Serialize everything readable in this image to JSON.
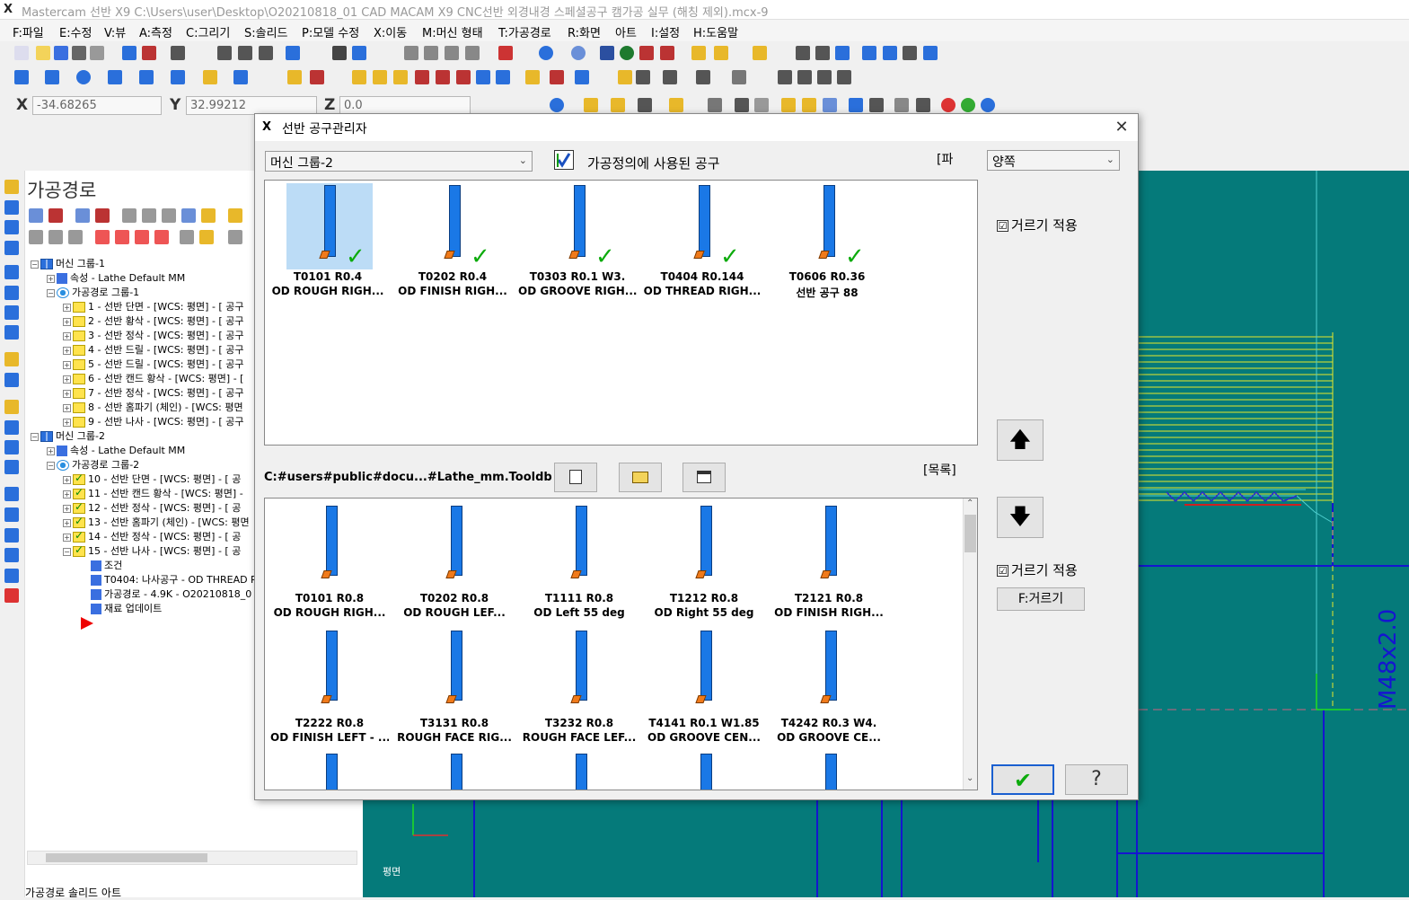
{
  "window_title": "Mastercam 선반 X9  C:\\Users\\user\\Desktop\\O20210818_01 CAD MACAM X9 CNC선반 외경내경 스페셜공구 캠가공 실무 (해칭 제외).mcx-9",
  "menu": [
    "F:파일",
    "E:수정",
    "V:뷰",
    "A:측정",
    "C:그리기",
    "S:솔리드",
    "P:모델 수정",
    "X:이동",
    "M:머신 형태",
    "T:가공경로",
    "R:화면",
    "아트",
    "I:설정",
    "H:도움말"
  ],
  "coords": {
    "x_label": "X",
    "x_value": "-34.68265",
    "y_label": "Y",
    "y_value": "32.99212",
    "z_label": "Z",
    "z_value": "0.0"
  },
  "panel": {
    "title": "가공경로",
    "tree": [
      {
        "text": "머신 그룹-1",
        "indent": 0,
        "icon": "grid",
        "exp": "−"
      },
      {
        "text": "속성 - Lathe Default MM",
        "indent": 1,
        "icon": "props",
        "exp": "+"
      },
      {
        "text": "가공경로 그룹-1",
        "indent": 1,
        "icon": "opsgroup",
        "exp": "−"
      },
      {
        "text": "1 - 선반 단면 - [WCS: 평면] - [ 공구",
        "indent": 2,
        "icon": "folder",
        "exp": "+"
      },
      {
        "text": "2 - 선반 황삭 - [WCS: 평면] - [ 공구",
        "indent": 2,
        "icon": "folder",
        "exp": "+"
      },
      {
        "text": "3 - 선반 정삭 - [WCS: 평면] - [ 공구",
        "indent": 2,
        "icon": "folder",
        "exp": "+"
      },
      {
        "text": "4 - 선반 드릴 - [WCS: 평면] - [ 공구",
        "indent": 2,
        "icon": "folder",
        "exp": "+"
      },
      {
        "text": "5 - 선반 드릴 - [WCS: 평면] - [ 공구",
        "indent": 2,
        "icon": "folder",
        "exp": "+"
      },
      {
        "text": "6 - 선반 캔드 황삭 - [WCS: 평면] - [",
        "indent": 2,
        "icon": "folder",
        "exp": "+"
      },
      {
        "text": "7 - 선반 정삭 - [WCS: 평면] - [ 공구",
        "indent": 2,
        "icon": "folder",
        "exp": "+"
      },
      {
        "text": "8 - 선반 홈파기 (체인) - [WCS: 평면",
        "indent": 2,
        "icon": "folder",
        "exp": "+"
      },
      {
        "text": "9 - 선반 나사 - [WCS: 평면] - [ 공구",
        "indent": 2,
        "icon": "folder",
        "exp": "+"
      },
      {
        "text": "머신 그룹-2",
        "indent": 0,
        "icon": "grid",
        "exp": "−"
      },
      {
        "text": "속성 - Lathe Default MM",
        "indent": 1,
        "icon": "props",
        "exp": "+"
      },
      {
        "text": "가공경로 그룹-2",
        "indent": 1,
        "icon": "opsgroup",
        "exp": "−"
      },
      {
        "text": "10 - 선반 단면 - [WCS: 평면] - [ 공",
        "indent": 2,
        "icon": "checkf",
        "exp": "+"
      },
      {
        "text": "11 - 선반 캔드 황삭 - [WCS: 평면] -",
        "indent": 2,
        "icon": "checkf",
        "exp": "+"
      },
      {
        "text": "12 - 선반 정삭 - [WCS: 평면] - [ 공",
        "indent": 2,
        "icon": "checkf",
        "exp": "+"
      },
      {
        "text": "13 - 선반 홈파기 (체인) - [WCS: 평면",
        "indent": 2,
        "icon": "checkf",
        "exp": "+"
      },
      {
        "text": "14 - 선반 정삭 - [WCS: 평면] - [ 공",
        "indent": 2,
        "icon": "checkf",
        "exp": "+"
      },
      {
        "text": "15 - 선반 나사 - [WCS: 평면] - [ 공",
        "indent": 2,
        "icon": "checkf",
        "exp": "−"
      },
      {
        "text": "조건",
        "indent": 3,
        "icon": "props",
        "exp": ""
      },
      {
        "text": "T0404: 나사공구 - OD THREAD R",
        "indent": 3,
        "icon": "props",
        "exp": ""
      },
      {
        "text": "가공경로 - 4.9K - O20210818_0",
        "indent": 3,
        "icon": "props",
        "exp": ""
      },
      {
        "text": "재료 업데이트",
        "indent": 3,
        "icon": "props",
        "exp": ""
      }
    ],
    "bottom_tabs": "가공경로   솔리드   아트"
  },
  "graphics": {
    "plane_label": "평면",
    "dim_text": "M48x2.0"
  },
  "dialog": {
    "title": "선반 공구관리자",
    "machine_group": "머신 그룹-2",
    "used_tools_label": "가공정의에 사용된 공구",
    "side_label": "[파",
    "side_select": "양쪽",
    "filter_apply_label": "거르기 적용",
    "filter_checked": "☑",
    "library_path": "C:#users#public#docu...#Lathe_mm.Tooldb",
    "list_label": "[목록]",
    "filter_button": "F:거르기",
    "ok_icon": "✔",
    "help_icon": "?",
    "up_icon": "🡅",
    "down_icon": "🡇",
    "used_tools": [
      {
        "line1": "T0101 R0.4",
        "line2": "OD ROUGH RIGH...",
        "selected": true
      },
      {
        "line1": "T0202 R0.4",
        "line2": "OD FINISH RIGH...",
        "selected": false
      },
      {
        "line1": "T0303 R0.1 W3.",
        "line2": "OD GROOVE RIGH...",
        "selected": false
      },
      {
        "line1": "T0404 R0.144",
        "line2": "OD THREAD RIGH...",
        "selected": false
      },
      {
        "line1": "T0606 R0.36",
        "line2": "선반 공구 88",
        "selected": false
      }
    ],
    "library_tools": [
      {
        "line1": "T0101 R0.8",
        "line2": "OD ROUGH RIGH..."
      },
      {
        "line1": "T0202 R0.8",
        "line2": "OD ROUGH LEF..."
      },
      {
        "line1": "T1111 R0.8",
        "line2": "OD Left 55 deg"
      },
      {
        "line1": "T1212 R0.8",
        "line2": "OD Right 55 deg"
      },
      {
        "line1": "T2121 R0.8",
        "line2": "OD FINISH RIGH..."
      },
      {
        "line1": "T2222 R0.8",
        "line2": "OD FINISH LEFT - ..."
      },
      {
        "line1": "T3131 R0.8",
        "line2": "ROUGH FACE RIG..."
      },
      {
        "line1": "T3232 R0.8",
        "line2": "ROUGH FACE LEF..."
      },
      {
        "line1": "T4141 R0.1 W1.85",
        "line2": "OD GROOVE CEN..."
      },
      {
        "line1": "T4242 R0.3 W4.",
        "line2": "OD GROOVE CE..."
      }
    ]
  }
}
